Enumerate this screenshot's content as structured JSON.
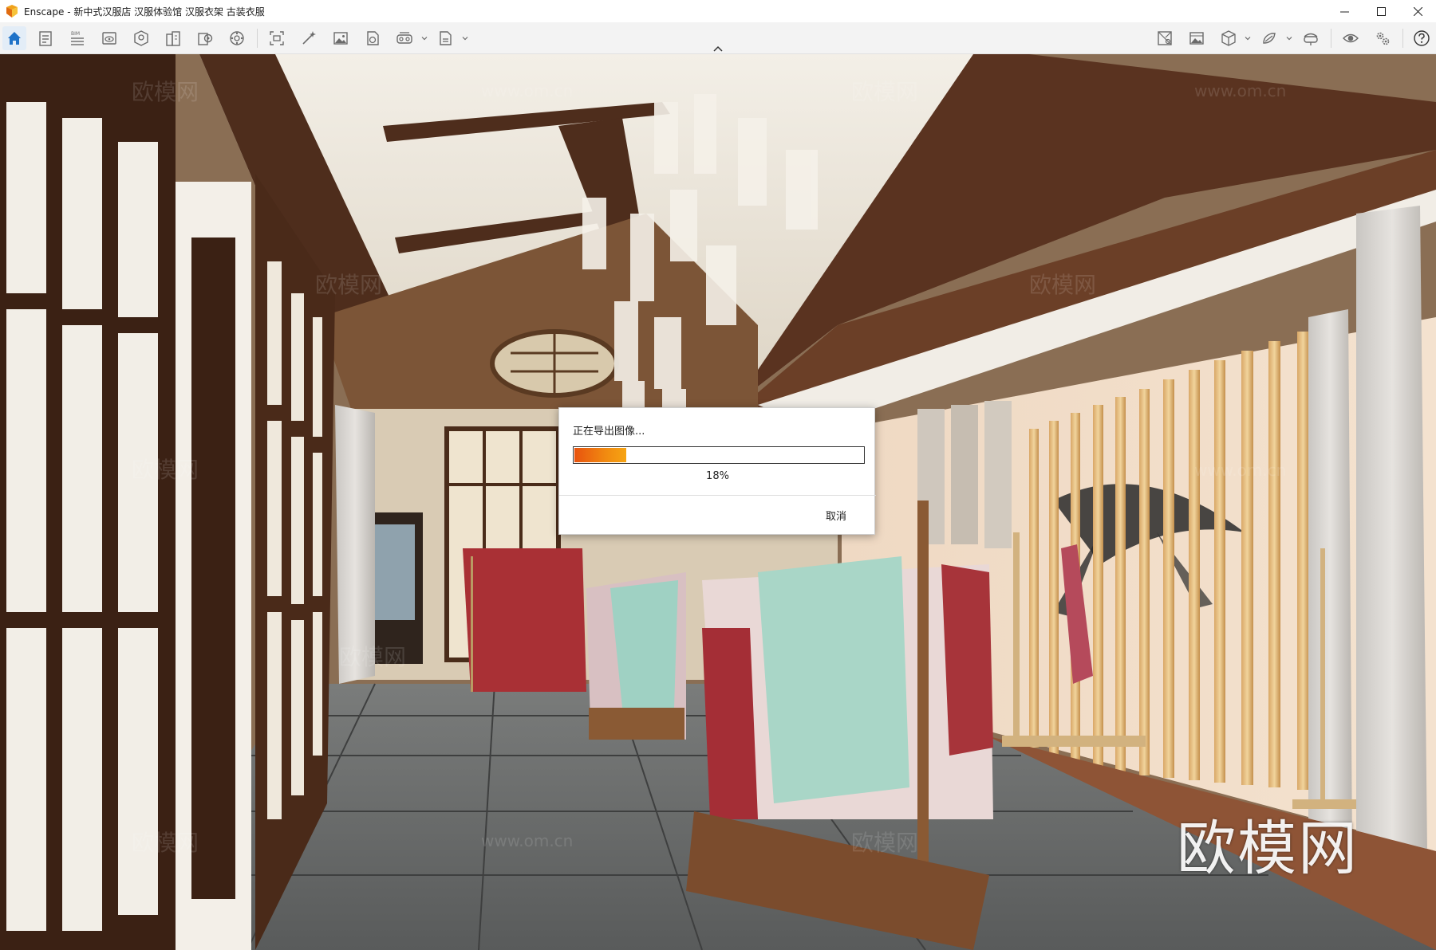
{
  "window": {
    "app_name": "Enscape",
    "title": "Enscape - 新中式汉服店 汉服体验馆 汉服衣架 古装衣服",
    "controls": [
      "minimize-icon",
      "maximize-icon",
      "close-icon"
    ]
  },
  "toolbar": {
    "left_icons": [
      "home-icon",
      "notes-icon",
      "bim-icon",
      "views-icon",
      "asset-library-icon",
      "building-icon",
      "material-editor-icon",
      "sun-icon",
      "screenshot-icon",
      "enhance-icon",
      "image-icon",
      "export-panorama-icon",
      "vr-icon",
      "batch-export-icon"
    ],
    "bim_label": "BIM",
    "right_icons": [
      "map-icon",
      "gallery-icon",
      "cube-icon",
      "paint-icon",
      "headset-icon",
      "visibility-icon",
      "settings-icon",
      "help-icon"
    ],
    "active_icon": "home-icon",
    "accent_color": "#1e72c8"
  },
  "dialog": {
    "title": "正在导出图像...",
    "progress": 0.18,
    "progress_text": "18%",
    "cancel_label": "取消"
  },
  "watermark": {
    "text": "欧模网",
    "url": "www.om.cn",
    "big_text": "欧模网"
  }
}
